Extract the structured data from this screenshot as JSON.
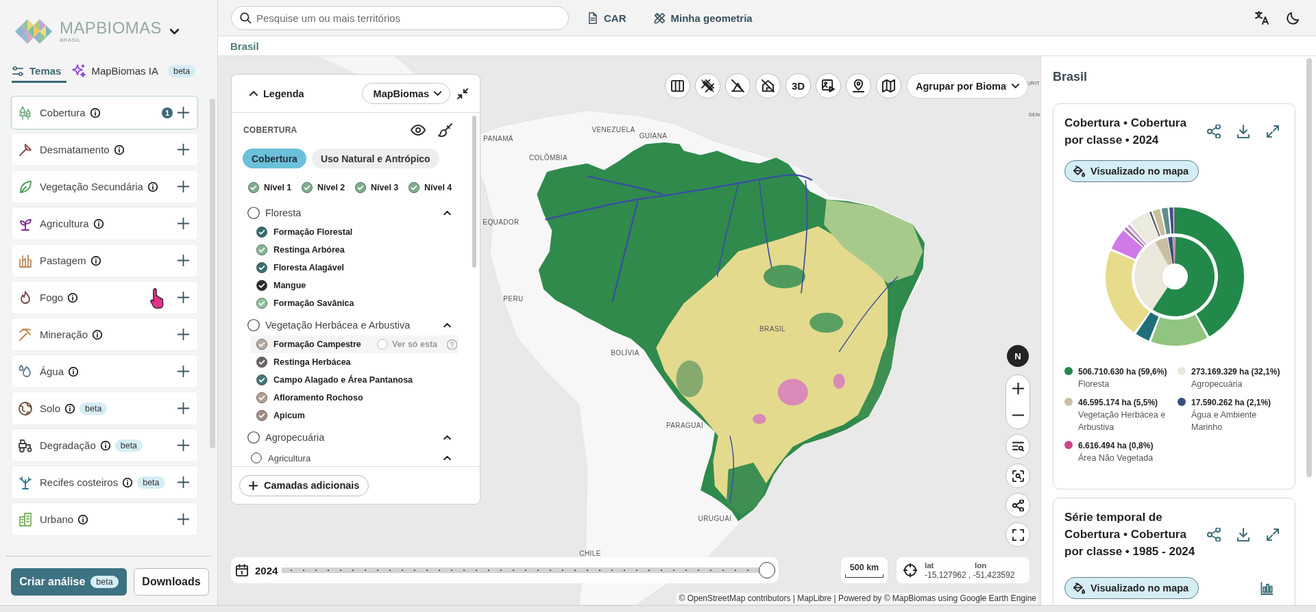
{
  "sidebar": {
    "logo": {
      "name": "MAPBIOMAS",
      "region": "BRASIL"
    },
    "tabs": [
      {
        "label": "Temas",
        "selected": true
      },
      {
        "label": "MapBiomas IA",
        "selected": false,
        "badge": "beta"
      }
    ],
    "themes": [
      {
        "label": "Cobertura",
        "selected": true,
        "count": "1"
      },
      {
        "label": "Desmatamento",
        "selected": false
      },
      {
        "label": "Vegetação Secundária",
        "selected": false
      },
      {
        "label": "Agricultura",
        "selected": false
      },
      {
        "label": "Pastagem",
        "selected": false
      },
      {
        "label": "Fogo",
        "selected": false
      },
      {
        "label": "Mineração",
        "selected": false
      },
      {
        "label": "Água",
        "selected": false
      },
      {
        "label": "Solo",
        "selected": false,
        "badge": "beta"
      },
      {
        "label": "Degradação",
        "selected": false,
        "badge": "beta"
      },
      {
        "label": "Recifes costeiros",
        "selected": false,
        "badge": "beta"
      },
      {
        "label": "Urbano",
        "selected": false
      }
    ],
    "actions": [
      {
        "kind": "primary",
        "label": "Criar análise",
        "badge": "beta"
      },
      {
        "kind": "secondary",
        "label": "Downloads"
      }
    ]
  },
  "topbar": {
    "search": {
      "placeholder": "Pesquise um ou mais territórios"
    },
    "links": [
      {
        "label": "CAR"
      },
      {
        "label": "Minha geometria"
      }
    ]
  },
  "breadcrumb": "Brasil",
  "legend": {
    "title": "Legenda",
    "expanded": true,
    "source": "MapBiomas",
    "section": "COBERTURA",
    "views": [
      {
        "label": "Cobertura",
        "selected": true
      },
      {
        "label": "Uso Natural e Antrópico",
        "selected": false
      }
    ],
    "levels": [
      {
        "label": "Nível 1",
        "checked": true
      },
      {
        "label": "Nível 2",
        "checked": true
      },
      {
        "label": "Nível 3",
        "checked": true
      },
      {
        "label": "Nível 4",
        "checked": true
      }
    ],
    "groups": [
      {
        "kind": "group",
        "label": "Floresta",
        "checked": false,
        "expanded": true,
        "children": [
          {
            "kind": "class",
            "label": "Formação Florestal",
            "checked": true,
            "color": "#2f6e6e"
          },
          {
            "kind": "class",
            "label": "Restinga Arbórea",
            "checked": true,
            "color": "#86b797"
          },
          {
            "kind": "class",
            "label": "Floresta Alagável",
            "checked": true,
            "color": "#37706f"
          },
          {
            "kind": "class",
            "label": "Mangue",
            "checked": true,
            "color": "#2b2b2b"
          },
          {
            "kind": "class",
            "label": "Formação Savânica",
            "checked": true,
            "color": "#8fc29c"
          }
        ]
      },
      {
        "kind": "group",
        "label": "Vegetação Herbácea e Arbustiva",
        "checked": false,
        "expanded": true,
        "children": [
          {
            "kind": "class",
            "label": "Formação Campestre",
            "checked": true,
            "color": "#b8aba4",
            "action": "Ver só esta"
          },
          {
            "kind": "class",
            "label": "Restinga Herbácea",
            "checked": true,
            "color": "#6e6161"
          },
          {
            "kind": "class",
            "label": "Campo Alagado e Área Pantanosa",
            "checked": true,
            "color": "#3f7877"
          },
          {
            "kind": "class",
            "label": "Afloramento Rochoso",
            "checked": true,
            "color": "#b49e96"
          },
          {
            "kind": "class",
            "label": "Apicum",
            "checked": true,
            "color": "#a38d85"
          }
        ]
      },
      {
        "kind": "group",
        "label": "Agropecuária",
        "checked": false,
        "expanded": true,
        "children": [
          {
            "kind": "group",
            "label": "Agricultura",
            "checked": false,
            "expanded": true
          }
        ]
      }
    ],
    "more_button": "Camadas adicionais"
  },
  "map": {
    "tools": [
      {
        "kind": "icon"
      },
      {
        "kind": "icon"
      },
      {
        "kind": "icon"
      },
      {
        "kind": "icon"
      },
      {
        "kind": "text",
        "label": "3D"
      },
      {
        "kind": "icon"
      },
      {
        "kind": "icon"
      },
      {
        "kind": "icon"
      }
    ],
    "group_by": "Agrupar por Bioma",
    "labels": [
      {
        "text": "PANAMÁ"
      },
      {
        "text": "VENEZUELA"
      },
      {
        "text": "GUIANA"
      },
      {
        "text": "COLÔMBIA"
      },
      {
        "text": "EQUADOR"
      },
      {
        "text": "PERU"
      },
      {
        "text": "BRASIL"
      },
      {
        "text": "BOLÍVIA"
      },
      {
        "text": "PARAGUAI"
      },
      {
        "text": "URUGUAI"
      },
      {
        "text": "CHILE"
      },
      {
        "text": "URIT"
      },
      {
        "text": "SEN"
      }
    ],
    "compass": "N",
    "timeline": {
      "year": "2024",
      "level": 1
    },
    "scale": "500 km",
    "coordinates": {
      "lat_label": "lat",
      "lat": "-15,127962",
      "lon_label": "lon",
      "lon": ", -51,423592"
    },
    "attribution": "© OpenStreetMap contributors | MapLibre | Powered by © MapBiomas using Google Earth Engine"
  },
  "panel": {
    "title": "Brasil",
    "cards": [
      {
        "kind": "donut",
        "title": "Cobertura • Cobertura por classe • 2024",
        "status": "Visualizado no mapa",
        "chart_data": {
          "type": "donut",
          "categories": [
            "Floresta",
            "Agropecuária",
            "Vegetação Herbácea e Arbustiva",
            "Água e Ambiente Marinho",
            "Área Não Vegetada"
          ],
          "values": [
            59.6,
            32.1,
            5.5,
            2.1,
            0.8
          ],
          "value_labels": [
            "506.710.630 ha (59,6%)",
            "273.169.329 ha (32,1%)",
            "46.595.174 ha (5,5%)",
            "17.590.262 ha (2,1%)",
            "6.616.494 ha (0,8%)"
          ]
        },
        "legend": [
          {
            "color": "#23894a"
          },
          {
            "color": "#ebe8dc"
          },
          {
            "color": "#c9bea3"
          },
          {
            "color": "#3b4f7a"
          },
          {
            "color": "#c94786"
          }
        ]
      },
      {
        "kind": "timeseries",
        "title": "Série temporal de Cobertura • Cobertura por classe • 1985 - 2024",
        "status": "Visualizado no mapa"
      }
    ]
  }
}
